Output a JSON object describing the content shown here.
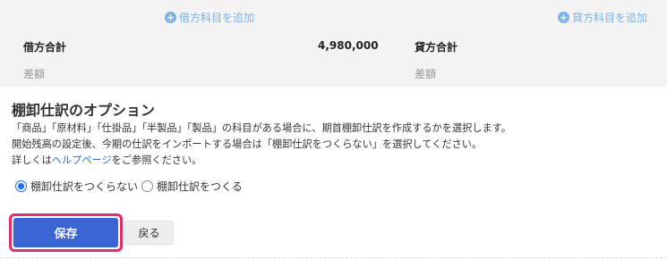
{
  "summary": {
    "add_debit_label": "借方科目を追加",
    "add_credit_label": "貸方科目を追加",
    "debit_total_label": "借方合計",
    "debit_total_amount": "4,980,000",
    "credit_total_label": "貸方合計",
    "debit_diff_label": "差額",
    "credit_diff_label": "差額"
  },
  "options": {
    "title": "棚卸仕訳のオプション",
    "desc_line1": "「商品」「原材料」「仕掛品」「半製品」「製品」の科目がある場合に、期首棚卸仕訳を作成するかを選択します。",
    "desc_line2": "開始残高の設定後、今期の仕訳をインポートする場合は「棚卸仕訳をつくらない」を選択してください。",
    "desc_line3_prefix": "詳しくは",
    "help_link": "ヘルプページ",
    "desc_line3_suffix": "をご参照ください。",
    "radio_no_create": "棚卸仕訳をつくらない",
    "radio_create": "棚卸仕訳をつくる",
    "selected": "棚卸仕訳をつくらない"
  },
  "actions": {
    "save_label": "保存",
    "back_label": "戻る"
  },
  "colors": {
    "save_button": "#3a64d2",
    "highlight": "#e0306b",
    "link": "#2e75c9",
    "add_link": "#7eb2e4"
  }
}
